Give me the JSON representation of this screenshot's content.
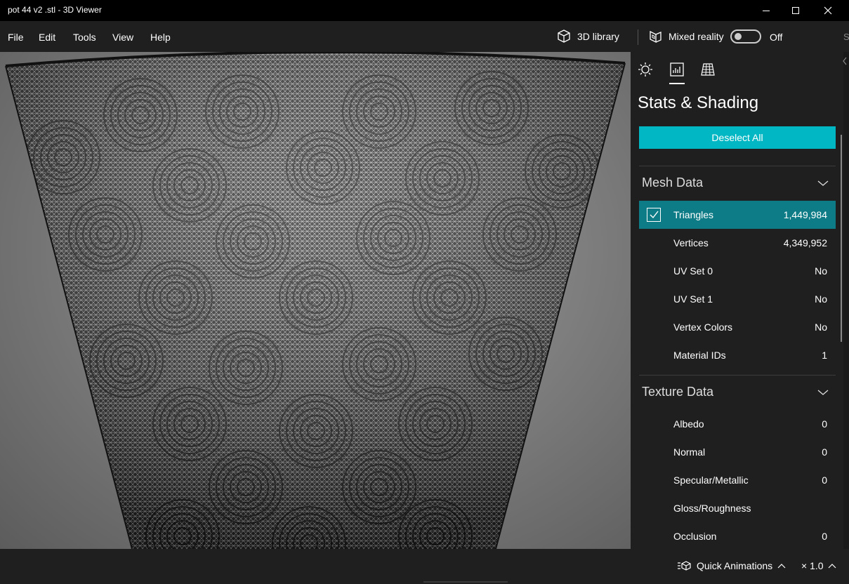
{
  "window": {
    "title": "pot 44 v2 .stl - 3D Viewer",
    "controls": [
      "minimize-icon",
      "maximize-icon",
      "close-icon"
    ]
  },
  "menu": {
    "items": [
      {
        "label": "File"
      },
      {
        "label": "Edit"
      },
      {
        "label": "Tools"
      },
      {
        "label": "View"
      },
      {
        "label": "Help"
      }
    ],
    "library_label": "3D library",
    "library_icon": "cube-icon",
    "mixed_reality_label": "Mixed reality",
    "mixed_reality_icon": "mixed-reality-icon",
    "mixed_reality_state": "Off",
    "edge_text": "S"
  },
  "viewport": {
    "model": "wireframe-pot",
    "background_color": "#808080"
  },
  "panel": {
    "tabs": [
      {
        "name": "lighting-tab",
        "icon": "sun-icon"
      },
      {
        "name": "stats-tab",
        "icon": "stats-icon",
        "selected": true
      },
      {
        "name": "grid-tab",
        "icon": "grid-icon"
      }
    ],
    "title": "Stats & Shading",
    "deselect_label": "Deselect All",
    "accent": "#00b7c3",
    "selected_row_color": "#0e7c86",
    "mesh": {
      "heading": "Mesh Data",
      "rows": [
        {
          "label": "Triangles",
          "value": "1,449,984",
          "checked": true
        },
        {
          "label": "Vertices",
          "value": "4,349,952"
        },
        {
          "label": "UV Set 0",
          "value": "No"
        },
        {
          "label": "UV Set 1",
          "value": "No"
        },
        {
          "label": "Vertex Colors",
          "value": "No"
        },
        {
          "label": "Material IDs",
          "value": "1"
        }
      ]
    },
    "texture": {
      "heading": "Texture Data",
      "rows": [
        {
          "label": "Albedo",
          "value": "0"
        },
        {
          "label": "Normal",
          "value": "0"
        },
        {
          "label": "Specular/Metallic",
          "value": "0"
        },
        {
          "label": "Gloss/Roughness",
          "value": ""
        },
        {
          "label": "Occlusion",
          "value": "0"
        }
      ]
    }
  },
  "bottom": {
    "quick_animations_label": "Quick Animations",
    "speed_label": "× 1.0"
  }
}
